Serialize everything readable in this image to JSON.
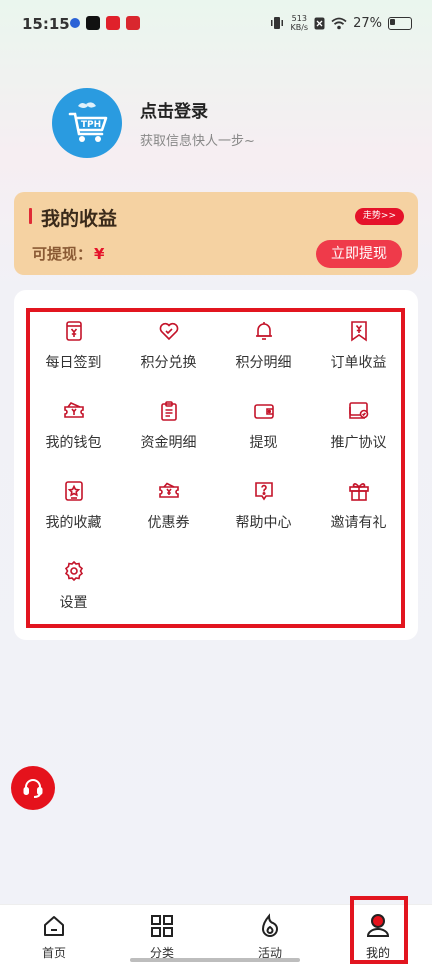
{
  "status_bar": {
    "time": "15:15",
    "net_speed_value": "513",
    "net_speed_unit": "KB/s",
    "battery_percent": "27%",
    "app_badges": [
      {
        "color": "#2a62d6"
      },
      {
        "color": "#111111"
      },
      {
        "color": "#e0212b"
      },
      {
        "color": "#d9272e"
      }
    ]
  },
  "profile": {
    "login_title": "点击登录",
    "login_subtitle": "获取信息快人一步~",
    "avatar_text": "TPH",
    "avatar_color": "#2a9be0"
  },
  "earnings": {
    "title": "我的收益",
    "trend_label": "走势>>",
    "withdrawable_label": "可提现：",
    "currency_symbol": "¥",
    "withdraw_button": "立即提现",
    "card_color": "#f5d2a2",
    "accent_color": "#e5122a"
  },
  "menu": {
    "icon_color": "#c4142a",
    "items": [
      {
        "label": "每日签到",
        "icon": "calendar-yen-icon"
      },
      {
        "label": "积分兑换",
        "icon": "heart-icon"
      },
      {
        "label": "积分明细",
        "icon": "bell-icon"
      },
      {
        "label": "订单收益",
        "icon": "receipt-yen-icon"
      },
      {
        "label": "我的钱包",
        "icon": "wallet-ticket-icon"
      },
      {
        "label": "资金明细",
        "icon": "clipboard-icon"
      },
      {
        "label": "提现",
        "icon": "wallet-icon"
      },
      {
        "label": "推广协议",
        "icon": "agreement-card-icon"
      },
      {
        "label": "我的收藏",
        "icon": "star-box-icon"
      },
      {
        "label": "优惠券",
        "icon": "coupon-icon"
      },
      {
        "label": "帮助中心",
        "icon": "help-icon"
      },
      {
        "label": "邀请有礼",
        "icon": "gift-icon"
      },
      {
        "label": "设置",
        "icon": "gear-icon"
      }
    ]
  },
  "tabs": [
    {
      "label": "首页",
      "icon": "home-icon"
    },
    {
      "label": "分类",
      "icon": "grid-icon"
    },
    {
      "label": "活动",
      "icon": "flame-icon"
    },
    {
      "label": "我的",
      "icon": "profile-icon",
      "active": true
    }
  ]
}
